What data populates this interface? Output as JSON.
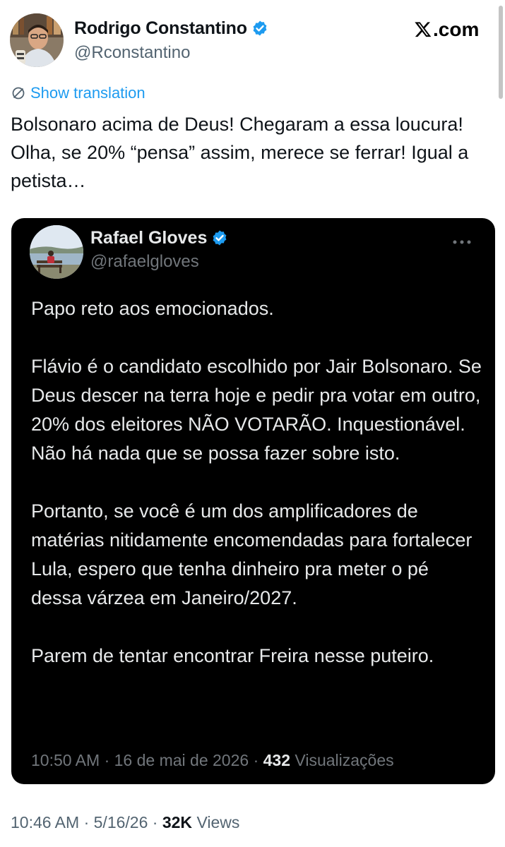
{
  "author": {
    "name": "Rodrigo Constantino",
    "handle": "@Rconstantino",
    "verified": true
  },
  "brand": {
    "logo_text": ".com"
  },
  "show_translation_label": "Show translation",
  "tweet_text": "Bolsonaro acima de Deus! Chegaram a essa loucura! Olha, se 20% “pensa” assim, merece se ferrar! Igual a petista…",
  "quoted": {
    "name": "Rafael Gloves",
    "handle": "@rafaelgloves",
    "verified": true,
    "paragraphs": [
      "Papo reto aos emocionados.",
      "Flávio é o candidato escolhido por Jair Bolsonaro. Se Deus descer na terra hoje e pedir pra votar em outro, 20% dos eleitores NÃO VOTARÃO. Inquestionável. Não há nada que se possa fazer sobre isto.",
      "Portanto, se você é um dos amplificadores de matérias nitidamente encomendadas para fortalecer Lula, espero que tenha dinheiro pra meter o pé dessa várzea em Janeiro/2027.",
      "Parem de tentar encontrar Freira nesse puteiro."
    ],
    "time": "10:50 AM",
    "date": "16 de mai de 2026",
    "views_count": "432",
    "views_label": "Visualizações"
  },
  "meta": {
    "time": "10:46 AM",
    "date": "5/16/26",
    "views_count": "32K",
    "views_label": "Views"
  },
  "colors": {
    "link": "#1d9bf0",
    "verified": "#1d9bf0",
    "text": "#0f1419",
    "secondary": "#536471",
    "card_bg": "#000000",
    "card_secondary": "#71767b"
  },
  "icons": {
    "verified": "verified-badge-icon",
    "translate": "globe-icon",
    "more": "more-horizontal-icon",
    "brand": "x-logo-icon"
  }
}
